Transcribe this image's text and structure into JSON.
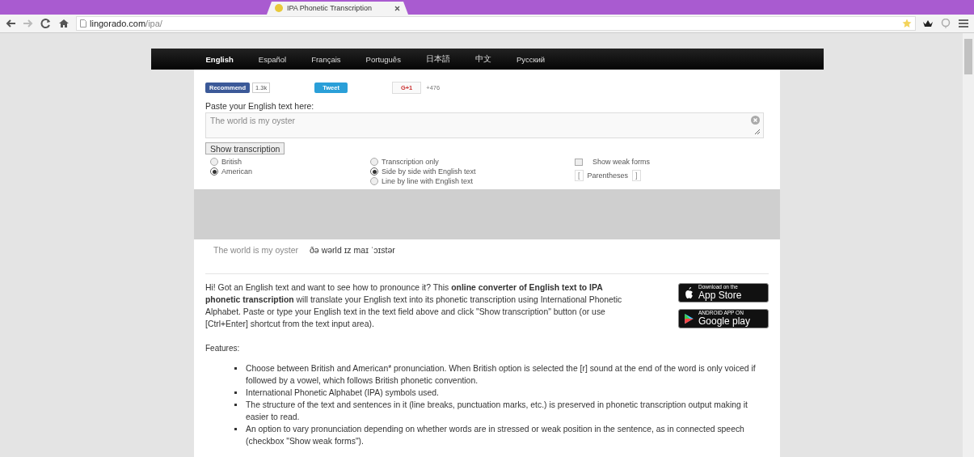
{
  "browser": {
    "tab_title": "IPA Phonetic Transcription",
    "address_host": "lingorado.com",
    "address_path": "/ipa/"
  },
  "nav": [
    {
      "label": "English",
      "selected": true
    },
    {
      "label": "Español",
      "selected": false
    },
    {
      "label": "Français",
      "selected": false
    },
    {
      "label": "Português",
      "selected": false
    },
    {
      "label": "日本語",
      "selected": false
    },
    {
      "label": "中文",
      "selected": false
    },
    {
      "label": "Русский",
      "selected": false
    }
  ],
  "social": {
    "recommend": "Recommend",
    "recommend_count": "1.3k",
    "tweet": "Tweet",
    "gplus": "G+1",
    "gplus_count": "+476"
  },
  "input": {
    "label": "Paste your English text here:",
    "value": "The world is my oyster"
  },
  "submit": "Show transcription",
  "accents": [
    {
      "label": "British",
      "selected": false
    },
    {
      "label": "American",
      "selected": true
    }
  ],
  "modes": [
    {
      "label": "Transcription only",
      "selected": false
    },
    {
      "label": "Side by side with English text",
      "selected": true
    },
    {
      "label": "Line by line with English text",
      "selected": false
    }
  ],
  "weak_forms": {
    "label": "Show weak forms",
    "checked": false
  },
  "parentheses": {
    "open": "[",
    "label": "Parentheses",
    "close": "]"
  },
  "output": {
    "english": "The world is my oyster",
    "ipa": "ðə wərld ɪz maɪ ˈɔɪstər"
  },
  "intro": "Hi! Got an English text and want to see how to pronounce it? This **online converter of English text to IPA phonetic transcription** will translate your English text into its phonetic transcription using International Phonetic Alphabet. Paste or type your English text in the text field above and click \"Show transcription\" button (or use [Ctrl+Enter] shortcut from the text input area).",
  "badges": [
    {
      "small": "Download on the",
      "big": "App Store",
      "kind": "apple"
    },
    {
      "small": "ANDROID APP ON",
      "big": "Google play",
      "kind": "google"
    }
  ],
  "features_heading": "Features:",
  "features": [
    "Choose between British and American* pronunciation. When British option is selected the [r] sound at the end of the word is only voiced if followed by a vowel, which follows British phonetic convention.",
    "International Phonetic Alphabet (IPA) symbols used.",
    "The structure of the text and sentences in it (line breaks, punctuation marks, etc.) is preserved in phonetic transcription output making it easier to read.",
    "An option to vary pronunciation depending on whether words are in stressed or weak position in the sentence, as in connected speech (checkbox \"Show weak forms\")."
  ]
}
